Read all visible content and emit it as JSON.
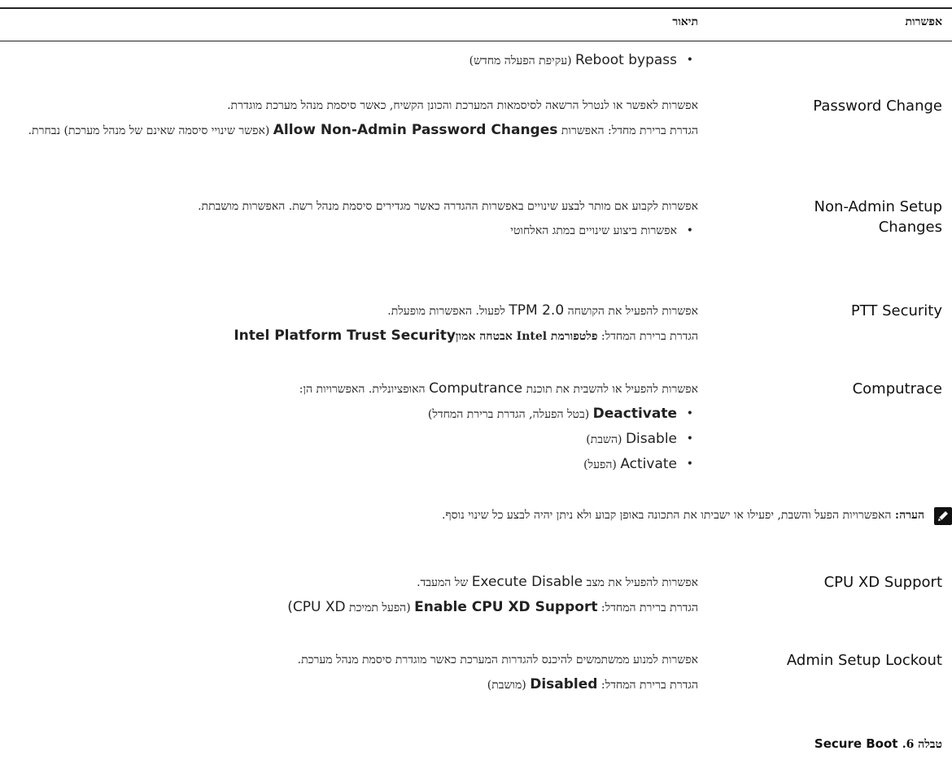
{
  "header": {
    "option": "אפשרות",
    "description": "תיאור"
  },
  "rows": [
    {
      "option": "",
      "bullets": [
        {
          "latin": "Reboot bypass",
          "hebrew": "(עקיפת הפעלה מחדש)"
        }
      ]
    },
    {
      "option": "Password Change",
      "text": "אפשרות לאפשר או לנטרל הרשאה לסיסמאות המערכת והכונן הקשיח, כאשר סיסמת מנהל מערכת מוגדרת.",
      "default_prefix": "הגדרת ברירת מחדל: האפשרות",
      "default_value": "Allow Non-Admin Password Changes",
      "default_suffix": "(אפשר שינויי סיסמה שאינם של מנהל מערכת) נבחרת."
    },
    {
      "option": "Non-Admin Setup Changes",
      "text": "אפשרות לקבוע אם מותר לבצע שינויים באפשרות ההגדרה כאשר מגדירים סיסמת מנהל רשת. האפשרות מושבתת.",
      "bullets": [
        {
          "hebrew": "אפשרות ביצוע שינויים במתג האלחוטי"
        }
      ]
    },
    {
      "option": "PTT Security",
      "text_prefix": "אפשרות להפעיל את הקושחה",
      "text_latin": "TPM 2.0",
      "text_suffix": "לפעול. האפשרות מופעלת.",
      "default_prefix": "הגדרת ברירת המחדל:",
      "default_value_hebrew": "פלטפורמת Intel אבטחה אמון",
      "default_value": "Intel Platform Trust Security"
    },
    {
      "option": "Computrace",
      "text_prefix": "אפשרות להפעיל או להשבית את תוכנת",
      "text_latin": "Computrance",
      "text_suffix": "האופציונלית. האפשרויות הן:",
      "bullets": [
        {
          "latin": "Deactivate",
          "hebrew": "(בטל הפעלה, הגדרת ברירת המחדל)",
          "bold": true
        },
        {
          "latin": "Disable",
          "hebrew": "(השבת)"
        },
        {
          "latin": "Activate",
          "hebrew": "(הפעל)"
        }
      ]
    },
    {
      "note_label": "הערה:",
      "note_text": "האפשרויות הפעל והשבת, יפעילו או ישביתו את התכונה באופן קבוע ולא ניתן יהיה לבצע כל שינוי נוסף."
    },
    {
      "option": "CPU XD Support",
      "text_prefix": "אפשרות להפעיל את מצב",
      "text_latin": "Execute Disable",
      "text_suffix": "של המעבד.",
      "default_prefix": "הגדרת ברירת המחדל:",
      "default_value": "Enable CPU XD Support",
      "default_suffix_hebrew": "(הפעל תמיכת",
      "default_suffix_latin": "CPU XD)"
    },
    {
      "option": "Admin Setup Lockout",
      "text": "אפשרות למנוע ממשתמשים להיכנס להגדרות המערכת כאשר מוגדרת סיסמת מנהל מערכת.",
      "default_prefix": "הגדרת ברירת המחדל:",
      "default_value": "Disabled",
      "default_suffix": "(מושבת)"
    }
  ],
  "caption": {
    "hebrew": "טבלה 6.",
    "latin": "Secure Boot"
  }
}
